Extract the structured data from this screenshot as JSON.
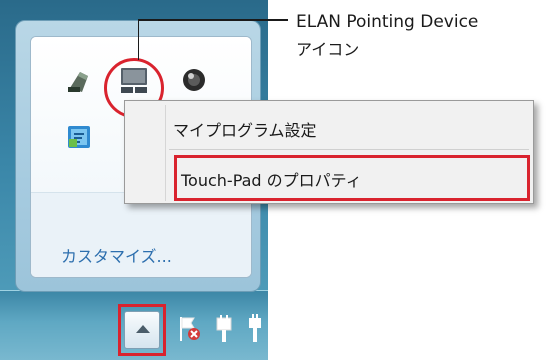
{
  "tray_flyout": {
    "customize_label": "カスタマイズ..."
  },
  "callout": {
    "title": "ELAN Pointing Device",
    "subtitle": "アイコン"
  },
  "context_menu": {
    "items": [
      {
        "label": "マイプログラム設定"
      },
      {
        "label": "Touch-Pad のプロパティ"
      }
    ]
  },
  "icons": {
    "network": "network-icon",
    "elan_touchpad": "elan-pointing-device-icon",
    "speaker": "speaker-icon",
    "input_method": "input-method-icon",
    "show_hidden": "chevron-up-icon",
    "action_center": "action-center-flag-icon",
    "power": "power-plug-icon",
    "network_taskbar": "network-plug-icon"
  },
  "colors": {
    "highlight_red": "#d9232e",
    "link_blue": "#2d6fae"
  }
}
